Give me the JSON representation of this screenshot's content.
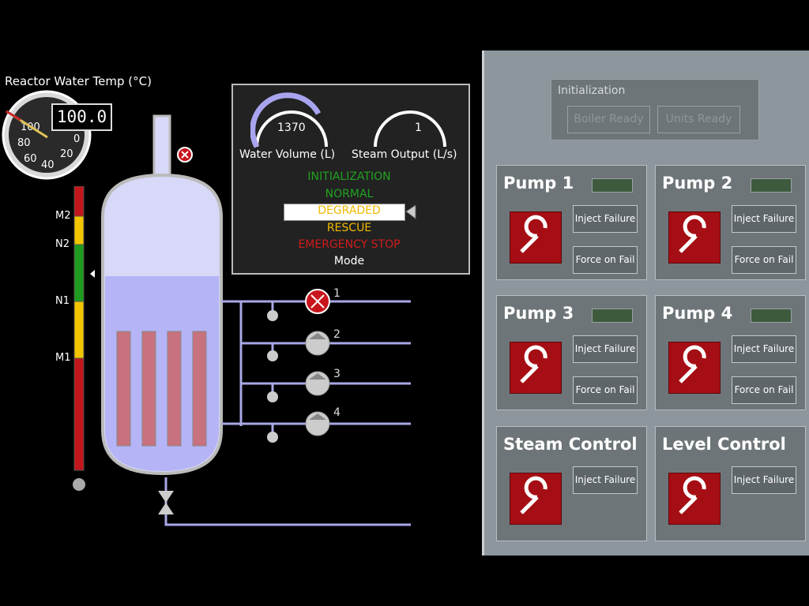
{
  "temperature": {
    "title": "Reactor Water Temp (°C)",
    "digital_value": "100.0",
    "ticks": [
      "100",
      "80",
      "60",
      "40",
      "20",
      "0"
    ]
  },
  "water_volume": {
    "value": "1370",
    "label": "Water Volume (L)"
  },
  "steam_output": {
    "value": "1",
    "label": "Steam Output (L/s)"
  },
  "mode": {
    "items": [
      {
        "label": "INITIALIZATION",
        "color": "#21a321"
      },
      {
        "label": "NORMAL",
        "color": "#21a321"
      },
      {
        "label": "DEGRADED",
        "color": "#f2b900"
      },
      {
        "label": "RESCUE",
        "color": "#f2b900"
      },
      {
        "label": "EMERGENCY STOP",
        "color": "#d11b1b"
      }
    ],
    "selected": "DEGRADED",
    "title": "Mode"
  },
  "level_bar": {
    "labels": [
      "M2",
      "N2",
      "N1",
      "M1"
    ]
  },
  "pumps_schematic": [
    "1",
    "2",
    "3",
    "4"
  ],
  "initialization": {
    "title": "Initialization",
    "boiler_ready": "Boiler Ready",
    "units_ready": "Units Ready"
  },
  "units": [
    {
      "title": "Pump 1",
      "inject": "Inject Failure",
      "force": "Force on Fail"
    },
    {
      "title": "Pump 2",
      "inject": "Inject Failure",
      "force": "Force on Fail"
    },
    {
      "title": "Pump 3",
      "inject": "Inject Failure",
      "force": "Force on Fail"
    },
    {
      "title": "Pump 4",
      "inject": "Inject Failure",
      "force": "Force on Fail"
    },
    {
      "title": "Steam Control",
      "inject": "Inject Failure"
    },
    {
      "title": "Level Control",
      "inject": "Inject Failure"
    }
  ],
  "colors": {
    "pipe": "#a8a8e6",
    "vessel": "#d8d8f8",
    "water": "#b4b4f6",
    "rods": "#c7727e",
    "failure": "#c8141c"
  }
}
